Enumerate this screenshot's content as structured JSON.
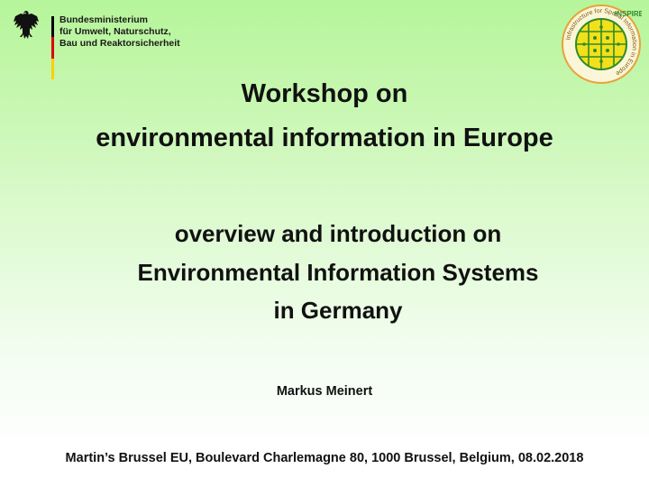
{
  "header": {
    "ministry_lines": [
      "Bundesministerium",
      "für Umwelt, Naturschutz,",
      "Bau und Reaktorsicherheit"
    ],
    "inspire_badge": "INSPIRE",
    "inspire_ring_text": "Infrastructure for Spatial Information in Europe"
  },
  "colors": {
    "flag_black": "#000000",
    "flag_red": "#dd0000",
    "flag_gold": "#ffce00",
    "inspire_green": "#2f8a2a",
    "inspire_yellow": "#f2e01a",
    "inspire_orange": "#e8a23a"
  },
  "title": {
    "line1": "Workshop on",
    "line2": "environmental information in Europe"
  },
  "subtitle": {
    "line1": "overview and introduction on",
    "line2": "Environmental Information Systems",
    "line3": "in Germany"
  },
  "author": "Markus Meinert",
  "venue": "Martin’s Brussel EU, Boulevard Charlemagne 80, 1000 Brussel, Belgium, 08.02.2018"
}
